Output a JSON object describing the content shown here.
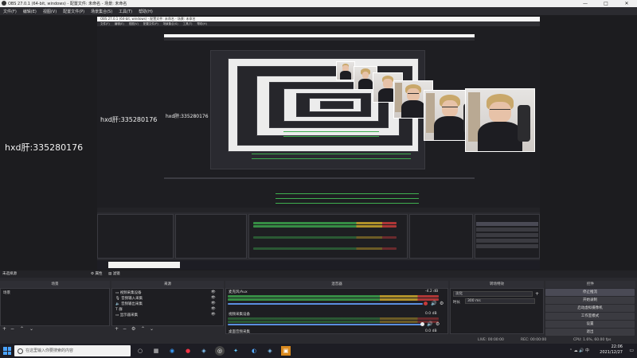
{
  "window": {
    "title": "OBS 27.0.1 (64-bit, windows) - 配置文件: 未命名 - 场景: 未命名",
    "controls": [
      "—",
      "□",
      "✕"
    ]
  },
  "menu": [
    "文件(F)",
    "编辑(E)",
    "视图(V)",
    "配置文件(P)",
    "场景集合(S)",
    "工具(T)",
    "帮助(H)"
  ],
  "preview": {
    "watermark_outer": "hxd肝:335280176",
    "watermark_mid": "hxd肝:335280176",
    "watermark_inner": "hxd肝:335280176"
  },
  "dock": {
    "source_strip": "未选择源",
    "properties_btn": "属性",
    "filters_btn": "滤镜",
    "scenes": {
      "title": "场景",
      "items": [
        "场景"
      ]
    },
    "sources": {
      "title": "来源",
      "items": [
        "视频采集设备",
        "音频输入采集",
        "音频输出采集",
        "群",
        "显示器采集"
      ]
    },
    "mixer": {
      "title": "混音器",
      "channels": [
        {
          "name": "麦克风/Aux",
          "db": "-4.2 dB"
        },
        {
          "name": "视频采集设备",
          "db": "0.0 dB"
        },
        {
          "name": "桌面音频采集",
          "db": "0.0 dB"
        }
      ]
    },
    "transitions": {
      "title": "转场特效",
      "type": "淡化",
      "duration_label": "时长",
      "duration": "300 ms"
    },
    "controls": {
      "title": "控件",
      "buttons": [
        "停止推流",
        "开始录制",
        "启动虚拟摄像机",
        "工作室模式",
        "设置",
        "退出"
      ]
    }
  },
  "status": {
    "live": "LIVE: 00:00:00",
    "rec": "REC: 00:00:00",
    "cpu": "CPU: 1.6%, 60.00 fps"
  },
  "taskbar": {
    "search_placeholder": "在这里输入你要搜索的内容",
    "time": "22:06",
    "date": "2021/12/27"
  },
  "colors": {
    "accent": "#4aa3ff",
    "meter_green": "#3aa04a",
    "meter_yellow": "#caa52c",
    "meter_red": "#c63a3a"
  }
}
